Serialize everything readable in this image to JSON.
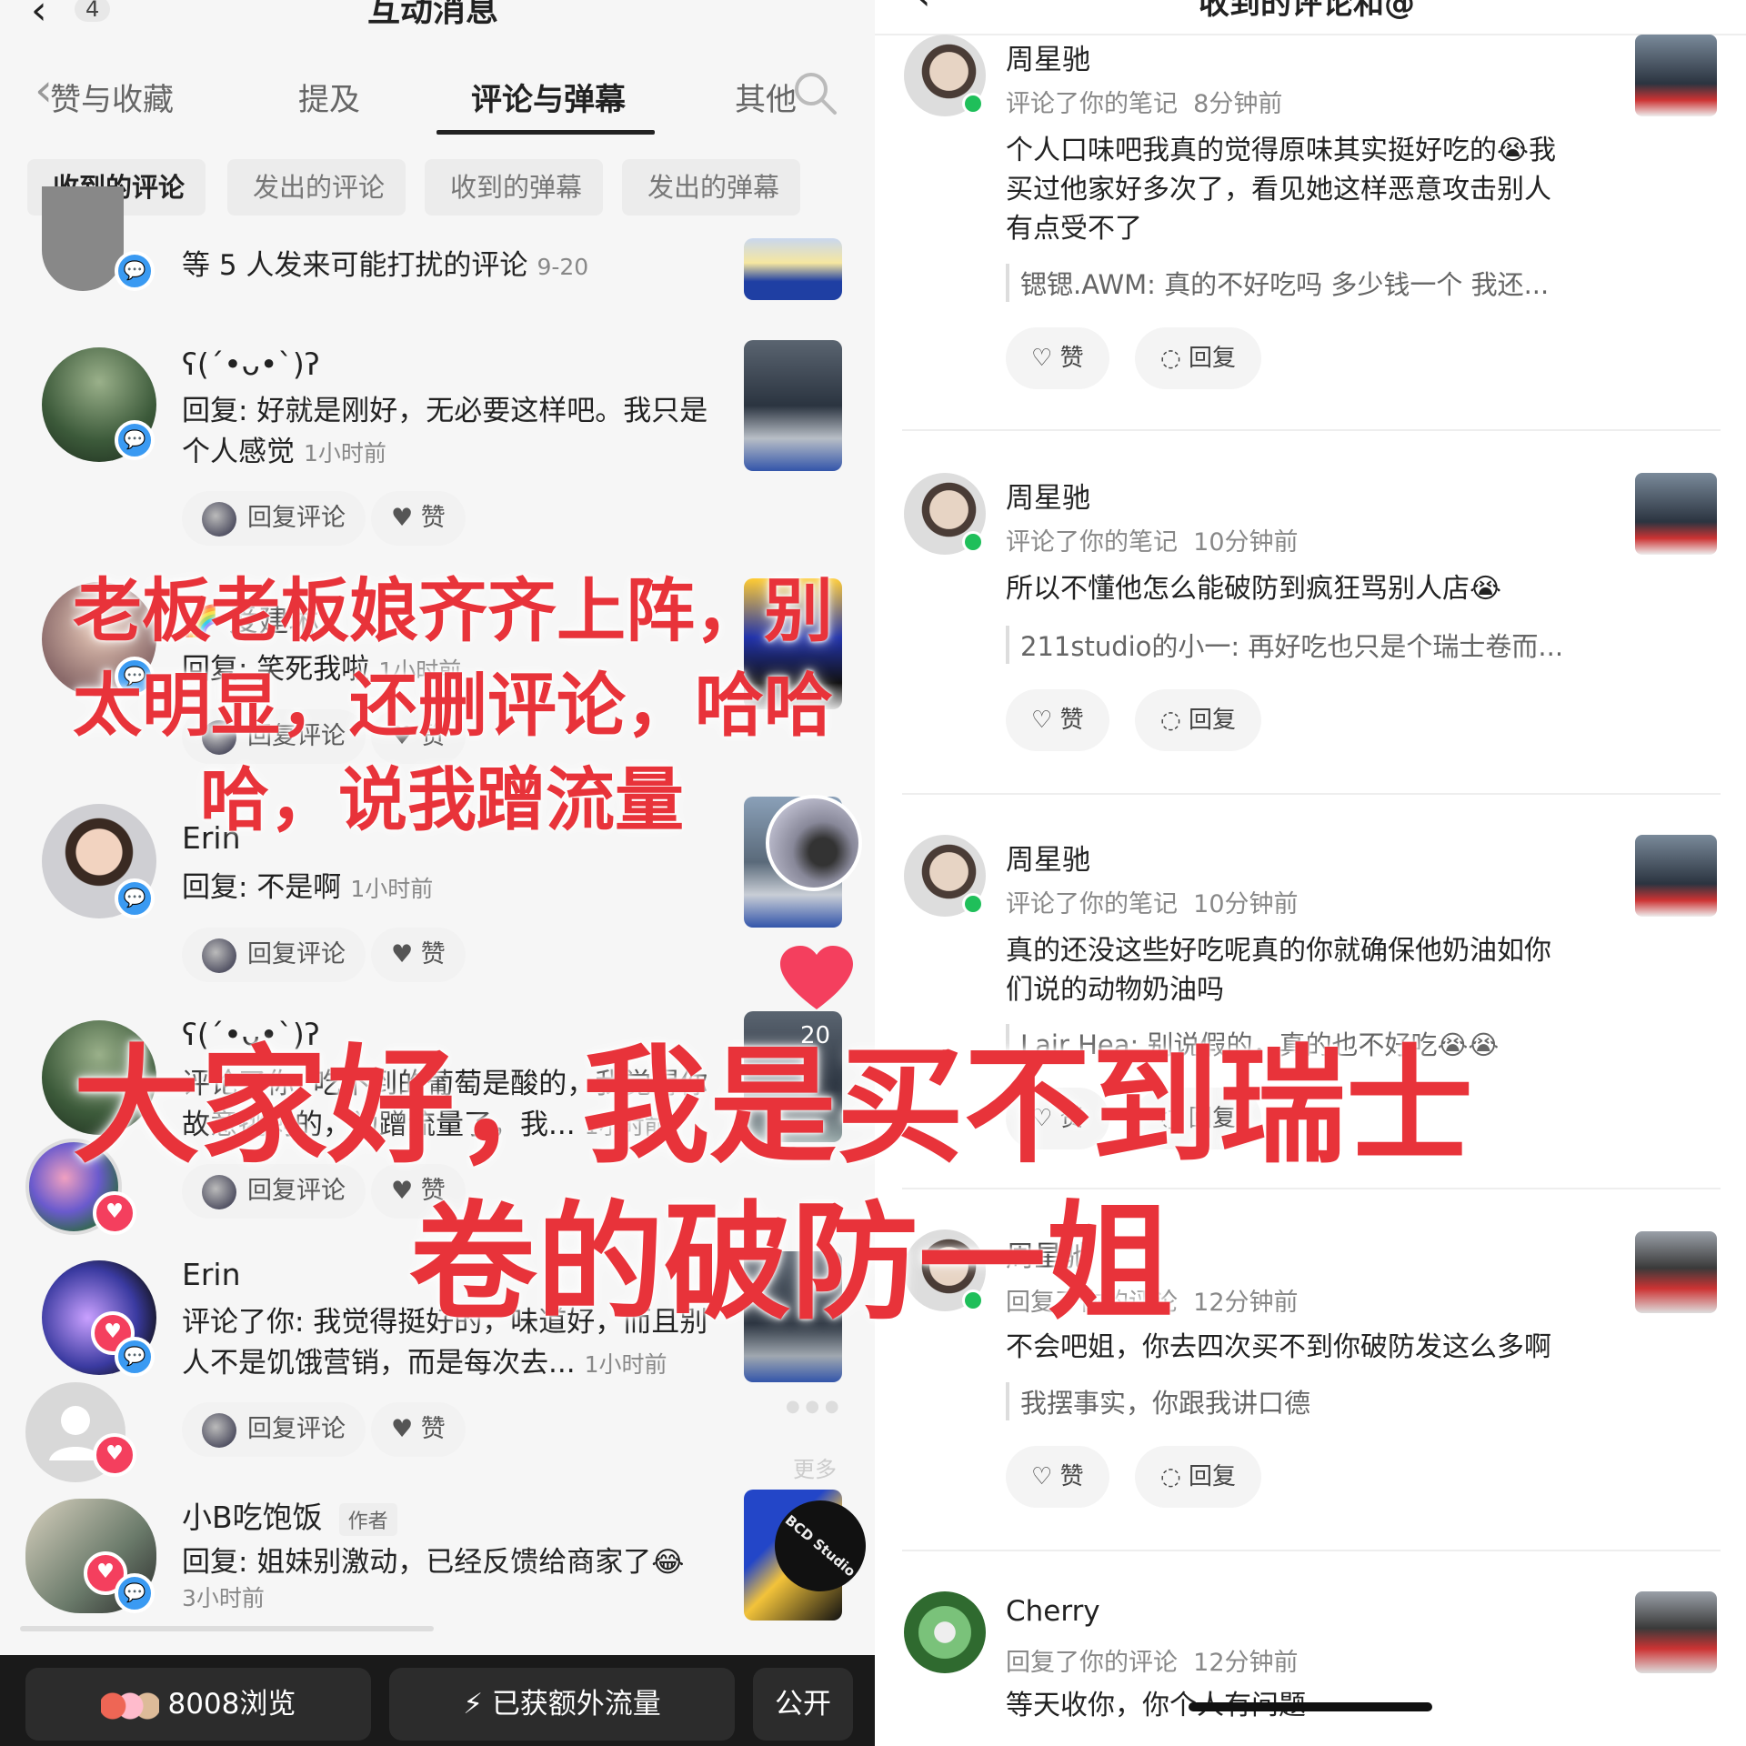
{
  "left": {
    "header": {
      "title": "互动消息",
      "back_count": "4"
    },
    "tabs": [
      {
        "label": "赞与收藏"
      },
      {
        "label": "提及"
      },
      {
        "label": "评论与弹幕"
      },
      {
        "label": "其他"
      }
    ],
    "subtabs": [
      {
        "label": "收到的评论"
      },
      {
        "label": "发出的评论"
      },
      {
        "label": "收到的弹幕"
      },
      {
        "label": "发出的弹幕"
      }
    ],
    "summary": {
      "text": "等 5 人发来可能打扰的评论",
      "date": "9-20"
    },
    "items": [
      {
        "name": "ʕ(ˊ•ᴗ•ˋ)ʔ",
        "text_line1": "回复: 好就是刚好，无必要这样吧。我只是",
        "text_line2": "个人感觉",
        "time": "1小时前",
        "reply": "回复评论",
        "like": "赞"
      },
      {
        "name": "🌈 爱建琳",
        "text_line1": "回复: 笑死我啦",
        "time": "1小时前",
        "reply": "回复评论",
        "like": "赞"
      },
      {
        "name": "Erin",
        "text_line1": "回复: 不是啊",
        "time": "1小时前",
        "reply": "回复评论",
        "like": "赞"
      },
      {
        "name": "ʕ(ˊ•ᴗ•ˋ)ʔ",
        "text_line1": "评论了你: 吃不到的葡萄是酸的，我觉得你",
        "text_line2": "故意挑刺的，为蹭流量了，我...",
        "time": "1小时前",
        "reply": "回复评论",
        "like": "赞"
      },
      {
        "name": "Erin",
        "text_line1": "评论了你: 我觉得挺好的，味道好，而且别",
        "text_line2": "人不是饥饿营销，而是每次去...",
        "time": "1小时前",
        "reply": "回复评论",
        "like": "赞"
      },
      {
        "name": "小B吃饱饭",
        "tag": "作者",
        "text_line1": "回复: 姐妹别激动，已经反馈给商家了😂",
        "time": "3小时前"
      }
    ],
    "video_counter": "20",
    "more_label": "更多",
    "thumb_brand": "BCD Studio",
    "bottom": {
      "views": "8008浏览",
      "traffic": "已获额外流量",
      "public": "公开"
    }
  },
  "right": {
    "header": {
      "title": "收到的评论和@"
    },
    "items": [
      {
        "name": "周星驰",
        "action": "评论了你的笔记",
        "time": "8分钟前",
        "body_line1": "个人口味吧我真的觉得原味其实挺好吃的😭我",
        "body_line2": "买过他家好多次了，看见她这样恶意攻击别人",
        "body_line3": "有点受不了",
        "quote": "锶锶.AWM: 真的不好吃吗 多少钱一个 我还...",
        "like": "赞",
        "reply": "回复"
      },
      {
        "name": "周星驰",
        "action": "评论了你的笔记",
        "time": "10分钟前",
        "body_line1": "所以不懂他怎么能破防到疯狂骂别人店😭",
        "quote": "211studio的小一: 再好吃也只是个瑞士卷而...",
        "like": "赞",
        "reply": "回复"
      },
      {
        "name": "周星驰",
        "action": "评论了你的笔记",
        "time": "10分钟前",
        "body_line1": "真的还没这些好吃呢真的你就确保他奶油如你",
        "body_line2": "们说的动物奶油吗",
        "quote": "Lair Hea: 别说假的，真的也不好吃😭😭",
        "like": "赞",
        "reply": "回复"
      },
      {
        "name": "周星驰",
        "action": "回复了你的评论",
        "time": "12分钟前",
        "body_line1": "不会吧姐，你去四次买不到你破防发这么多啊",
        "quote": "我摆事实，你跟我讲口德",
        "like": "赞",
        "reply": "回复"
      },
      {
        "name": "Cherry",
        "action": "回复了你的评论",
        "time": "12分钟前",
        "body_line1": "等天收你，你个人有问题"
      }
    ]
  },
  "overlay": {
    "caption1_line1": "老板老板娘齐齐上阵，别",
    "caption1_line2": "太明显，还删评论，哈哈",
    "caption1_line3": "哈，说我蹭流量",
    "caption2_line1": "大家好，我是买不到瑞士",
    "caption2_line2": "卷的破防一姐"
  },
  "colors": {
    "accent_red": "#e8333a",
    "badge_blue": "#3a9af2",
    "heart_pink": "#f43f5e",
    "online_green": "#1fbf5a"
  }
}
